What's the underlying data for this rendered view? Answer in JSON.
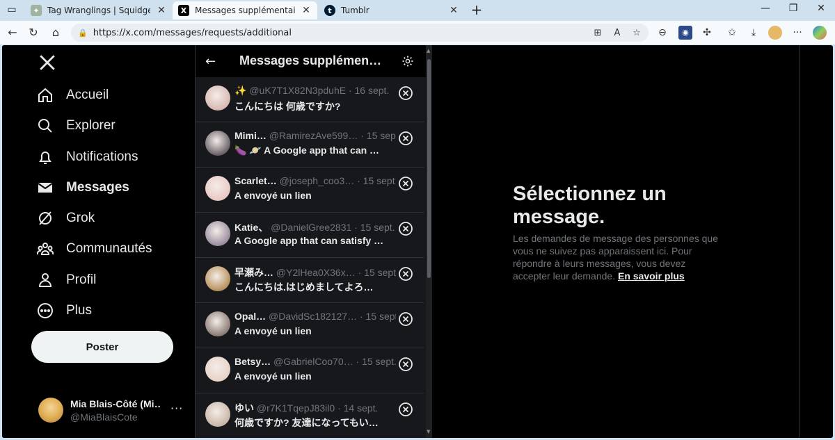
{
  "browser": {
    "tabs": [
      {
        "title": "Tag Wranglings | SquidgeWorld A",
        "active": false
      },
      {
        "title": "Messages supplémentaires / X",
        "active": true
      },
      {
        "title": "Tumblr",
        "active": false
      }
    ],
    "url": "https://x.com/messages/requests/additional"
  },
  "sidebar": {
    "items": [
      {
        "label": "Accueil",
        "icon": "home-icon"
      },
      {
        "label": "Explorer",
        "icon": "search-icon"
      },
      {
        "label": "Notifications",
        "icon": "bell-icon"
      },
      {
        "label": "Messages",
        "icon": "mail-icon"
      },
      {
        "label": "Grok",
        "icon": "grok-icon"
      },
      {
        "label": "Communautés",
        "icon": "communities-icon"
      },
      {
        "label": "Profil",
        "icon": "person-icon"
      },
      {
        "label": "Plus",
        "icon": "more-circle-icon"
      }
    ],
    "post_label": "Poster",
    "account": {
      "name": "Mia Blais-Côté (Mi…",
      "handle": "@MiaBlaisCote",
      "more": "···"
    }
  },
  "requests": {
    "title": "Messages supplémen…",
    "items": [
      {
        "name": "✨",
        "handle": "@uK7T1X82N3pduhE",
        "date": "· 16 sept.",
        "preview": "こんにちは 何歳ですか?",
        "avatar_color": "#d8b8b2"
      },
      {
        "name": "Mimi…",
        "handle": "@RamirezAve599…",
        "date": "· 15 sept.",
        "preview": "🍆 🪐 A Google app that can …",
        "avatar_color": "#6b6268"
      },
      {
        "name": "Scarlet…",
        "handle": "@joseph_coo3…",
        "date": "· 15 sept.",
        "preview": "A envoyé un lien",
        "avatar_color": "#e9c9c3"
      },
      {
        "name": "Katie、",
        "handle": "@DanielGree2831",
        "date": "· 15 sept.",
        "preview": "A Google app that can satisfy …",
        "avatar_color": "#9a8ea0"
      },
      {
        "name": "早瀬み…",
        "handle": "@Y2lHea0X36x…",
        "date": "· 15 sept.",
        "preview": "こんにちは.はじめましてよろ…",
        "avatar_color": "#b8925c"
      },
      {
        "name": "Opal…",
        "handle": "@DavidSc182127…",
        "date": "· 15 sept.",
        "preview": "A envoyé un lien",
        "avatar_color": "#8c7c76"
      },
      {
        "name": "Betsy…",
        "handle": "@GabrielCoo70…",
        "date": "· 15 sept.",
        "preview": "A envoyé un lien",
        "avatar_color": "#e6d3c6"
      },
      {
        "name": "ゆい",
        "handle": "@r7K1TqepJ83il0",
        "date": "· 14 sept.",
        "preview": "何歳ですか? 友達になってもい…",
        "avatar_color": "#c9b6a6"
      }
    ]
  },
  "detail": {
    "heading": "Sélectionnez un message.",
    "body": "Les demandes de message des personnes que vous ne suivez pas apparaissent ici. Pour répondre à leurs messages, vous devez accepter leur demande.",
    "link": "En savoir plus"
  }
}
